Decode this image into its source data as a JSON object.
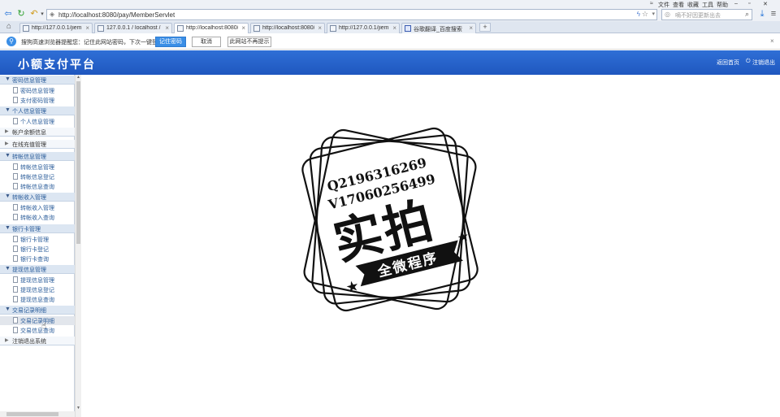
{
  "menubar": {
    "items": [
      "文件",
      "查看",
      "收藏",
      "工具",
      "帮助"
    ]
  },
  "address": {
    "url": "http://localhost:8080/pay/MemberServlet"
  },
  "search": {
    "placeholder": "嘀不好因更新出去"
  },
  "tabs": [
    {
      "label": "http://127.0.0.1/jiemia"
    },
    {
      "label": "127.0.0.1 / localhost / "
    },
    {
      "label": "http://localhost:8080/p"
    },
    {
      "label": "http://localhost:8080/c"
    },
    {
      "label": "http://127.0.0.1/jiemia"
    },
    {
      "label": "谷歌翻译_百度搜索"
    }
  ],
  "pwbar": {
    "message": "搜狗高速浏览器提醒您：记住此网站密码，下次一键登录！",
    "save": "记住密码",
    "cancel": "取消",
    "never": "此网站不再提示"
  },
  "header": {
    "brand": "小额支付平台",
    "home": "返回首页",
    "logout": "注销退出"
  },
  "sidebar": {
    "groups": [
      {
        "label": "密码信息管理",
        "items": [
          "密码信息管理",
          "支付密码管理"
        ]
      },
      {
        "label": "个人信息管理",
        "items": [
          "个人信息管理"
        ]
      },
      {
        "label": "帐户余额信息",
        "items": []
      },
      {
        "label": "在线充值管理",
        "items": []
      },
      {
        "label": "转帐信息管理",
        "items": [
          "转帐信息管理",
          "转帐信息登记",
          "转帐信息查询"
        ]
      },
      {
        "label": "转帐收入管理",
        "items": [
          "转帐收入管理",
          "转帐收入查询"
        ]
      },
      {
        "label": "银行卡管理",
        "items": [
          "银行卡管理",
          "银行卡登记",
          "银行卡查询"
        ]
      },
      {
        "label": "提现信息管理",
        "items": [
          "提现信息管理",
          "提现信息登记",
          "提现信息查询"
        ]
      },
      {
        "label": "交易记录明细",
        "items": [
          "交易记录明细",
          "交易信息查询"
        ]
      },
      {
        "label": "注销退出系统",
        "items": []
      }
    ]
  },
  "stamp": {
    "line1": "Q2196316269",
    "line2": "V17060256499",
    "main": "实拍",
    "banner": "全微程序"
  }
}
